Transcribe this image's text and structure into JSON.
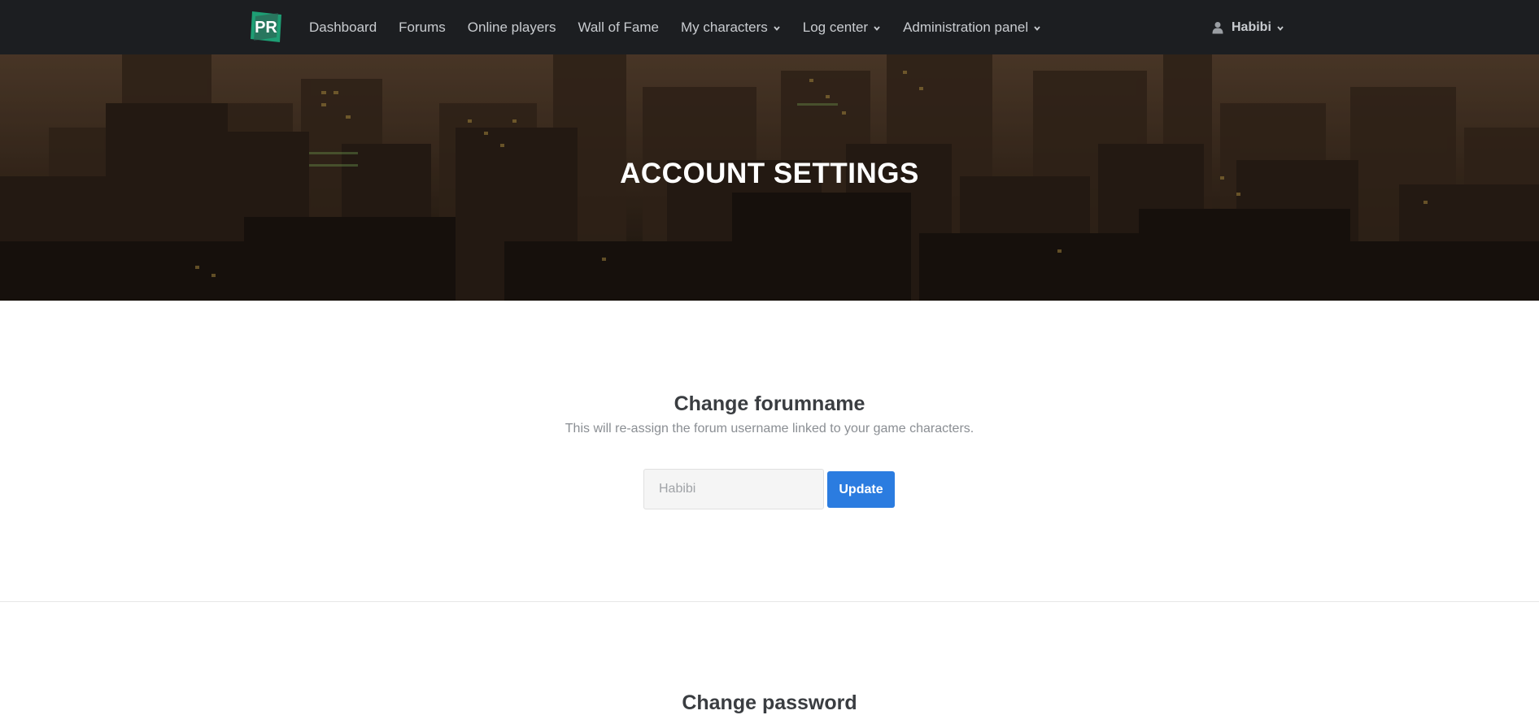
{
  "navbar": {
    "items": [
      {
        "label": "Dashboard",
        "dropdown": false
      },
      {
        "label": "Forums",
        "dropdown": false
      },
      {
        "label": "Online players",
        "dropdown": false
      },
      {
        "label": "Wall of Fame",
        "dropdown": false
      },
      {
        "label": "My characters",
        "dropdown": true
      },
      {
        "label": "Log center",
        "dropdown": true
      },
      {
        "label": "Administration panel",
        "dropdown": true
      }
    ],
    "user": {
      "name": "Habibi",
      "icon": "user-icon"
    }
  },
  "hero": {
    "title": "ACCOUNT SETTINGS"
  },
  "forumname": {
    "title": "Change forumname",
    "subtitle": "This will re-assign the forum username linked to your game characters.",
    "input_placeholder": "Habibi",
    "button_label": "Update"
  },
  "password": {
    "title": "Change password"
  },
  "colors": {
    "navbar_bg": "#1c1e21",
    "accent": "#2b7ce0",
    "logo_green": "#1e9e74"
  }
}
